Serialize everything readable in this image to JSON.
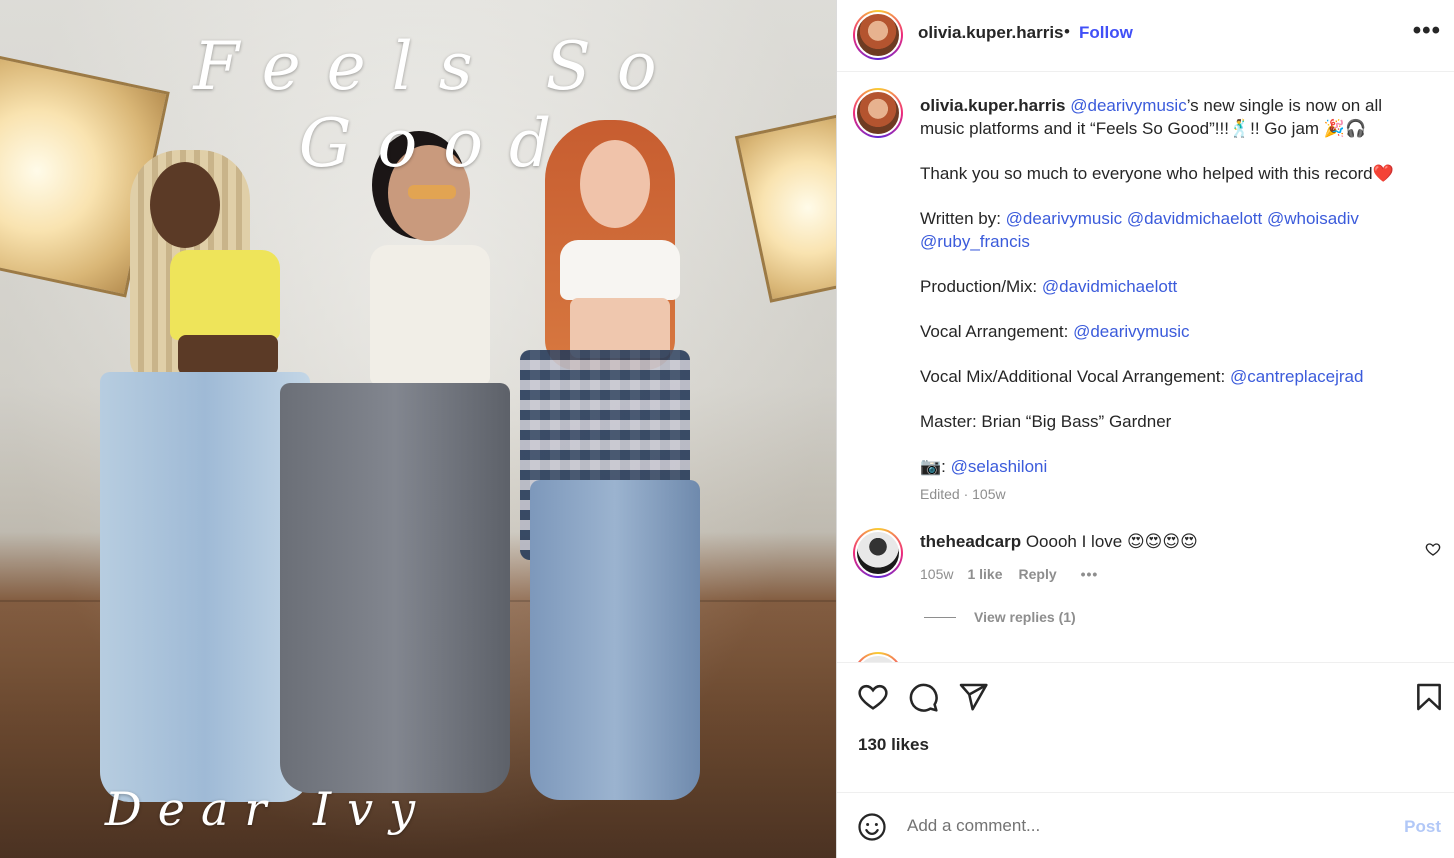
{
  "media": {
    "cover_title": "Feels So Good",
    "cover_artist": "Dear Ivy"
  },
  "header": {
    "username": "olivia.kuper.harris",
    "separator": "•",
    "follow_label": "Follow",
    "more_label": "•••"
  },
  "caption": {
    "username": "olivia.kuper.harris",
    "line1_mention": "@dearivymusic",
    "line1_text": "’s new single is now on all music platforms and it “Feels So Good”!!!🕺!! Go jam 🎉🎧",
    "thanks": "Thank you so much to everyone who helped with this record❤️",
    "written_label": "Written by: ",
    "written_mentions": [
      "@dearivymusic",
      "@davidmichaelott",
      "@whoisadiv",
      "@ruby_francis"
    ],
    "production_label": "Production/Mix: ",
    "production_mention": "@davidmichaelott",
    "vocal_arr_label": "Vocal Arrangement: ",
    "vocal_arr_mention": "@dearivymusic",
    "vocal_mix_label": "Vocal Mix/Additional Vocal Arrangement: ",
    "vocal_mix_mention": "@cantreplacejrad",
    "master_text": "Master: Brian “Big Bass” Gardner",
    "camera_label": "📷: ",
    "camera_mention": "@selashiloni",
    "meta": "Edited · 105w"
  },
  "comment1": {
    "username": "theheadcarp",
    "text": "Ooooh I love 😍😍😍😍",
    "time": "105w",
    "likes": "1 like",
    "reply": "Reply",
    "more": "•••",
    "view_replies": "View replies (1)"
  },
  "actions": {
    "icons": [
      "heart-icon",
      "comment-icon",
      "share-icon",
      "bookmark-icon"
    ],
    "likes_count": "130 likes"
  },
  "add_comment": {
    "placeholder": "Add a comment...",
    "post_label": "Post"
  },
  "colors": {
    "link": "#3b5bdb",
    "follow": "#4150f7",
    "post_disabled": "#b2c8f7",
    "muted": "#8e8e8e"
  }
}
